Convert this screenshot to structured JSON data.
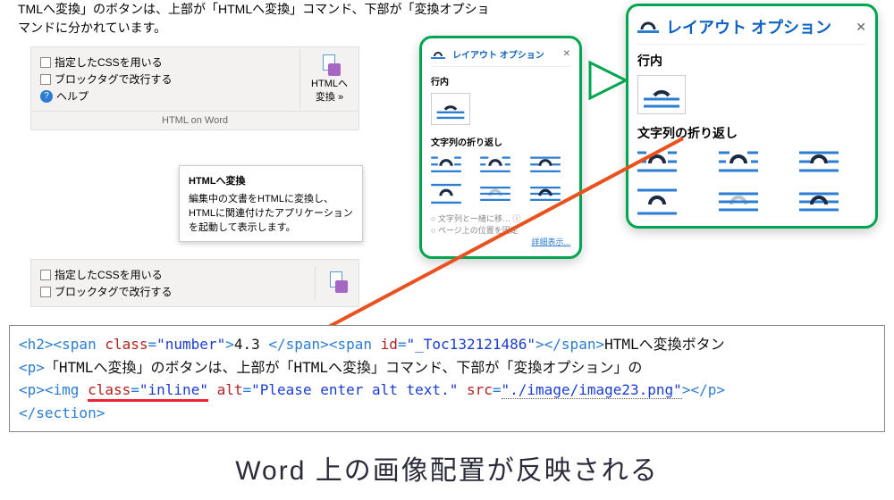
{
  "intro": {
    "line1": "TMLへ変換」のボタンは、上部が「HTMLへ変換」コマンド、下部が「変換オプショ",
    "line2": "マンドに分かれています。"
  },
  "ribbon": {
    "check1": "指定したCSSを用いる",
    "check2": "ブロックタグで改行する",
    "help": "ヘルプ",
    "btnLabel1": "HTMLへ",
    "btnLabel2": "変換 »",
    "group": "HTML on Word"
  },
  "tooltip": {
    "title": "HTMLへ変換",
    "body": "編集中の文書をHTMLに変換し、HTMLに関連付けたアプリケーションを起動して表示します。"
  },
  "layout": {
    "title": "レイアウト オプション",
    "close": "✕",
    "sect_inline": "行内",
    "sect_wrap": "文字列の折り返し"
  },
  "layout_small": {
    "footer1": "文字列と一緒に移…",
    "footer2": "ページ上の位置を固定",
    "more": "詳細表示..."
  },
  "code": {
    "h2_open": "<h2>",
    "span1_open": "<span ",
    "class_attr": "class",
    "eq": "=",
    "number_val": "\"number\"",
    "gt": ">",
    "sec_num": "4.3  ",
    "sp_close": "</span>",
    "span2_open": "<span ",
    "id_attr": "id",
    "id_val": "\"_Toc132121486\"",
    "sp_close2": "</span>",
    "h2_text": "HTMLへ変換ボタン",
    "p_open": "<p>",
    "p1_text": "「HTMLへ変換」のボタンは、上部が「HTMLへ変換」コマンド、下部が「変換オプション」の",
    "img_open": "<img ",
    "inline_val": "\"inline\"",
    "alt_attr": "alt",
    "alt_val": "\"Please enter alt text.\"",
    "src_attr": "src",
    "src_val": "\"./image/image23.png\"",
    "slash_gt": ">",
    "p_close": "</p>",
    "sec_close": "</section>"
  },
  "caption": "Word 上の画像配置が反映される"
}
